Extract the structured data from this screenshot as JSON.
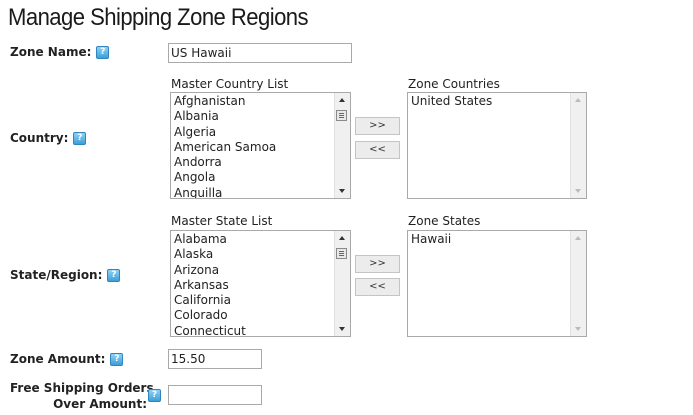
{
  "page": {
    "title": "Manage Shipping Zone Regions"
  },
  "help_glyph": "?",
  "zone_name": {
    "label": "Zone Name:",
    "value": "US Hawaii"
  },
  "country": {
    "label": "Country:",
    "master_caption": "Master Country List",
    "zone_caption": "Zone Countries",
    "master_items": [
      "Afghanistan",
      "Albania",
      "Algeria",
      "American Samoa",
      "Andorra",
      "Angola",
      "Anguilla"
    ],
    "zone_items": [
      "United States"
    ],
    "add_label": ">>",
    "remove_label": "<<"
  },
  "state": {
    "label": "State/Region:",
    "master_caption": "Master State List",
    "zone_caption": "Zone States",
    "master_items": [
      "Alabama",
      "Alaska",
      "Arizona",
      "Arkansas",
      "California",
      "Colorado",
      "Connecticut"
    ],
    "zone_items": [
      "Hawaii"
    ],
    "add_label": ">>",
    "remove_label": "<<"
  },
  "zone_amount": {
    "label": "Zone Amount:",
    "value": "15.50"
  },
  "free_shipping": {
    "label_line1": "Free Shipping Orders",
    "label_line2": "Over Amount:",
    "value": ""
  }
}
